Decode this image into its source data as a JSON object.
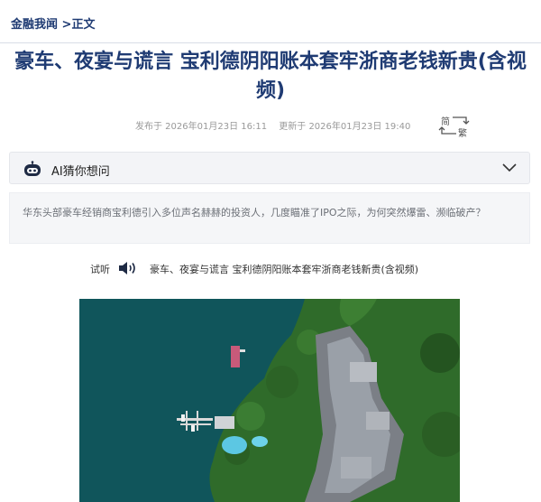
{
  "breadcrumb": {
    "home": "金融我闻",
    "sep": " >",
    "current": "正文"
  },
  "article": {
    "title": "豪车、夜宴与谎言 宝利德阴阳账本套牢浙商老钱新贵(含视频)",
    "published": "发布于 2026年01月23日 16:11",
    "updated": "更新于 2026年01月23日 19:40",
    "summary": "华东头部豪车经销商宝利德引入多位声名赫赫的投资人，几度瞄准了IPO之际，为何突然爆雷、濒临破产？"
  },
  "lang_toggle": {
    "simplified": "简",
    "traditional": "繁"
  },
  "ai_bar": {
    "label": "AI猜你想问",
    "icon": "robot-icon",
    "expand_icon": "chevron-down-icon"
  },
  "audio": {
    "label": "试听",
    "icon": "speaker-icon",
    "title": "豪车、夜宴与谎言 宝利德阴阳账本套牢浙商老钱新贵(含视频)"
  },
  "image": {
    "subject": "aerial-lakeside-resort",
    "water_color": "#0f5057",
    "foliage_color": "#2f6b2a"
  }
}
